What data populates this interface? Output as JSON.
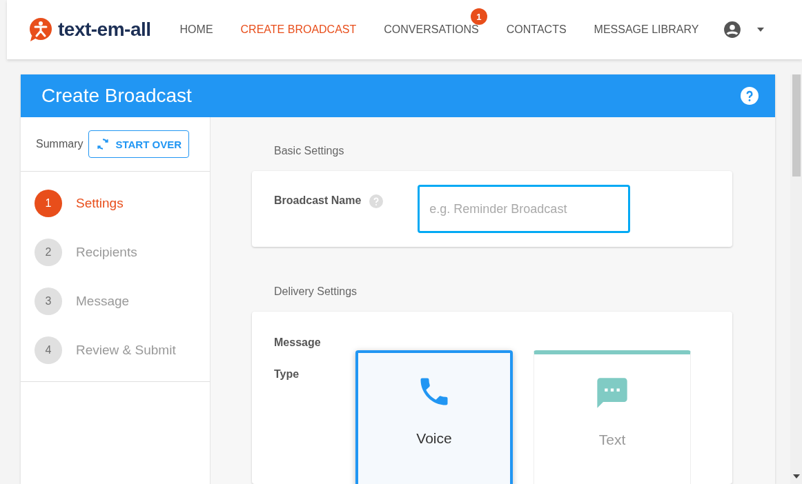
{
  "brand": {
    "name": "text-em-all"
  },
  "nav": [
    {
      "label": "HOME",
      "selected": false
    },
    {
      "label": "CREATE BROADCAST",
      "selected": true
    },
    {
      "label": "CONVERSATIONS",
      "selected": false,
      "badge": "1"
    },
    {
      "label": "CONTACTS",
      "selected": false
    },
    {
      "label": "MESSAGE LIBRARY",
      "selected": false
    }
  ],
  "header": {
    "title": "Create Broadcast"
  },
  "sidebar": {
    "summary": "Summary",
    "start_over": "START OVER",
    "steps": [
      {
        "number": "1",
        "label": "Settings",
        "selected": true
      },
      {
        "number": "2",
        "label": "Recipients",
        "selected": false
      },
      {
        "number": "3",
        "label": "Message",
        "selected": false
      },
      {
        "number": "4",
        "label": "Review & Submit",
        "selected": false
      }
    ]
  },
  "basic": {
    "heading": "Basic Settings",
    "name_label": "Broadcast Name",
    "placeholder": "e.g. Reminder Broadcast"
  },
  "delivery": {
    "heading": "Delivery Settings",
    "type_label": "Message Type",
    "types": [
      {
        "kind": "voice",
        "label": "Voice",
        "selected": true
      },
      {
        "kind": "text",
        "label": "Text",
        "selected": false
      }
    ]
  }
}
